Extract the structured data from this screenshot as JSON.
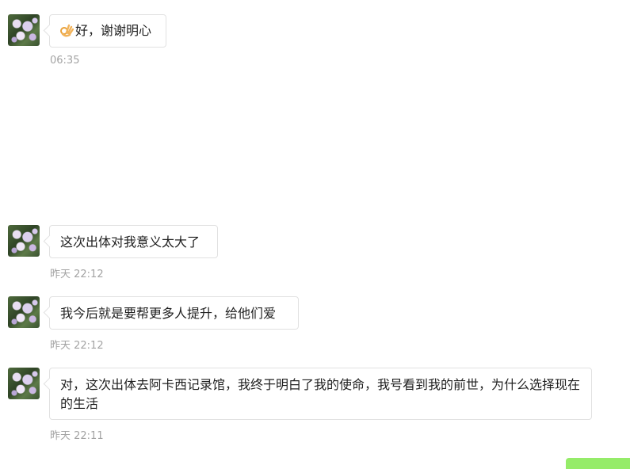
{
  "messages": [
    {
      "text": "好，谢谢明心",
      "emoji": "ok-hand-emoji",
      "timestamp": "06:35"
    },
    {
      "text": "这次出体对我意义太大了",
      "timestamp": "昨天 22:12"
    },
    {
      "text": "我今后就是要帮更多人提升，给他们爱",
      "timestamp": "昨天 22:12"
    },
    {
      "text": "对，这次出体去阿卡西记录馆，我终于明白了我的使命，我号看到我的前世，为什么选择现在的生活",
      "timestamp": "昨天 22:11"
    }
  ],
  "colors": {
    "bubble_border": "#e1e1e1",
    "timestamp": "#a3a3a3",
    "own_bubble": "#95ec69"
  }
}
